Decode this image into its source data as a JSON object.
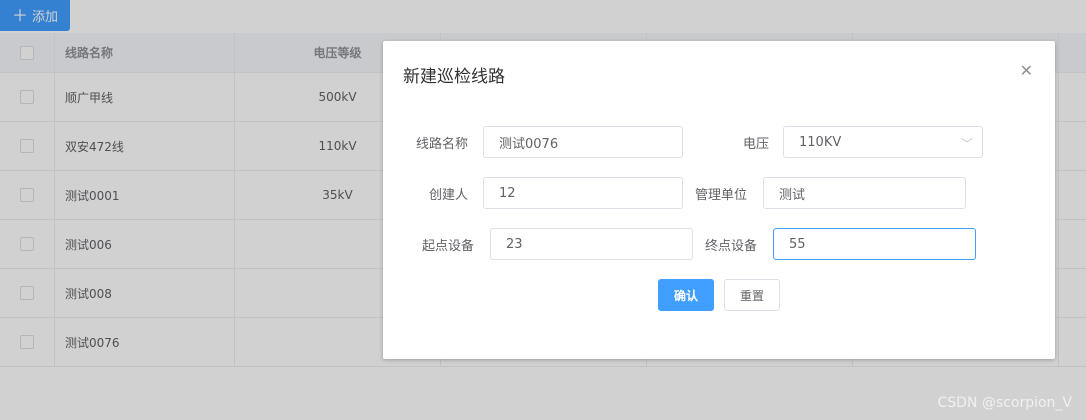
{
  "toolbar": {
    "add_label": "添加"
  },
  "table": {
    "headers": [
      "线路名称",
      "电压等级"
    ],
    "rows": [
      {
        "name": "顺广甲线",
        "voltage": "500kV"
      },
      {
        "name": "双安472线",
        "voltage": "110kV"
      },
      {
        "name": "测试0001",
        "voltage": "35kV"
      },
      {
        "name": "测试006",
        "voltage": ""
      },
      {
        "name": "测试008",
        "voltage": ""
      },
      {
        "name": "测试0076",
        "voltage": ""
      }
    ]
  },
  "dialog": {
    "title": "新建巡检线路",
    "fields": {
      "line_name": {
        "label": "线路名称",
        "value": "测试0076"
      },
      "voltage": {
        "label": "电压",
        "value": "110KV"
      },
      "creator": {
        "label": "创建人",
        "value": "12"
      },
      "unit": {
        "label": "管理单位",
        "value": "测试"
      },
      "start_device": {
        "label": "起点设备",
        "value": "23"
      },
      "end_device": {
        "label": "终点设备",
        "value": "55"
      }
    },
    "confirm_label": "确认",
    "reset_label": "重置"
  },
  "watermark": "CSDN @scorpion_V",
  "colors": {
    "primary": "#409eff",
    "overlay": "rgba(0,0,0,0.18)"
  }
}
